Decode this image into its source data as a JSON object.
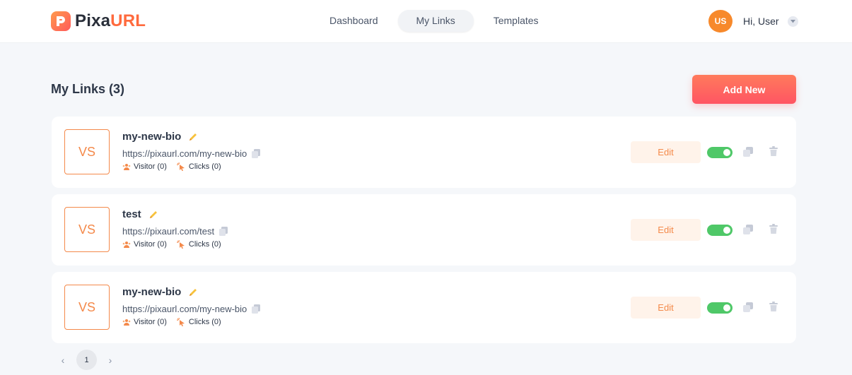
{
  "brand": {
    "name_part1": "Pixa",
    "name_part2": "URL"
  },
  "nav": {
    "items": [
      {
        "label": "Dashboard",
        "active": false
      },
      {
        "label": "My Links",
        "active": true
      },
      {
        "label": "Templates",
        "active": false
      }
    ]
  },
  "user": {
    "initials": "US",
    "greeting": "Hi, User"
  },
  "page": {
    "title": "My Links (3)",
    "add_label": "Add New"
  },
  "links": [
    {
      "initials": "VS",
      "name": "my-new-bio",
      "url": "https://pixaurl.com/my-new-bio",
      "visitors": "Visitor (0)",
      "clicks": "Clicks (0)",
      "edit_label": "Edit",
      "enabled": true
    },
    {
      "initials": "VS",
      "name": "test",
      "url": "https://pixaurl.com/test",
      "visitors": "Visitor (0)",
      "clicks": "Clicks (0)",
      "edit_label": "Edit",
      "enabled": true
    },
    {
      "initials": "VS",
      "name": "my-new-bio",
      "url": "https://pixaurl.com/my-new-bio",
      "visitors": "Visitor (0)",
      "clicks": "Clicks (0)",
      "edit_label": "Edit",
      "enabled": true
    }
  ],
  "pagination": {
    "prev": "‹",
    "current": "1",
    "next": "›"
  },
  "colors": {
    "accent": "#f4894a",
    "toggle_on": "#4fc868",
    "brand_gradient_start": "#ff7a5c",
    "brand_gradient_end": "#ff5563"
  }
}
